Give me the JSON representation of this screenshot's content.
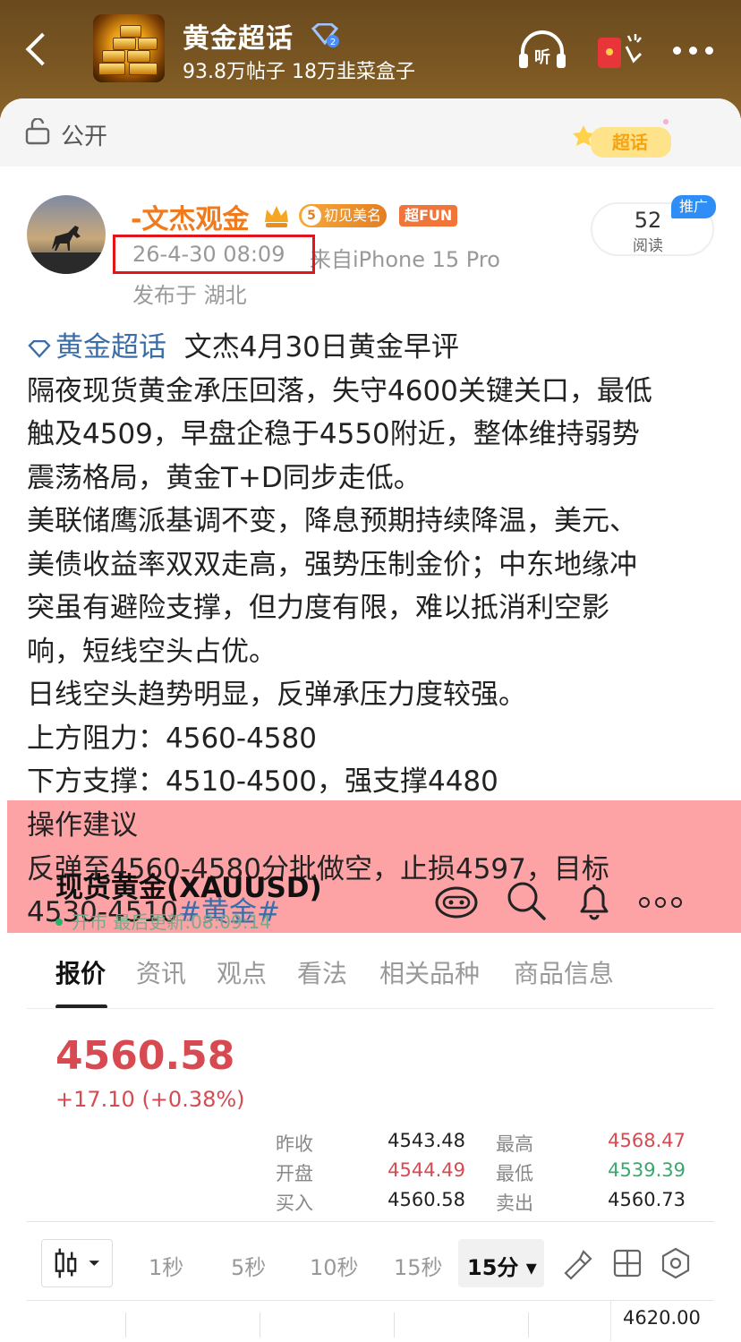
{
  "header": {
    "topic_name": "黄金超话",
    "topic_stats": "93.8万帖子 18万韭菜盒子",
    "icons": [
      "back-arrow-icon",
      "verified-diamond-icon",
      "listen-icon",
      "red-packet-icon",
      "more-icon"
    ]
  },
  "visibility": {
    "label": "公开",
    "icon": "unlock-icon",
    "badge_text": "超话"
  },
  "author": {
    "name": "-文杰观金",
    "level": "5",
    "badge_meet": "初见美名",
    "badge_fun": "超FUN",
    "time": "26-4-30 08:09",
    "source": "来自iPhone 15 Pro",
    "location": "发布于 湖北"
  },
  "reads": {
    "count": "52",
    "label": "阅读",
    "promo": "推广"
  },
  "post": {
    "topic_link": "黄金超话",
    "lines": [
      "文杰4月30日黄金早评",
      "隔夜现货黄金承压回落，失守4600关键关口，最低",
      "触及4509，早盘企稳于4550附近，整体维持弱势",
      "震荡格局，黄金T+D同步走低。",
      "美联储鹰派基调不变，降息预期持续降温，美元、",
      "美债收益率双双走高，强势压制金价；中东地缘冲",
      "突虽有避险支撑，但力度有限，难以抵消利空影",
      "响，短线空头占优。",
      "日线空头趋势明显，反弹承压力度较强。",
      "上方阻力：4560-4580",
      "下方支撑：4510-4500，强支撑4480"
    ],
    "advice_lines": [
      "操作建议",
      "反弹至4560-4580分批做空，止损4597，目标"
    ],
    "advice_last": " 4530-4510",
    "hashtag": "#黄金#"
  },
  "quote": {
    "title": "现货黄金(XAUUSD)",
    "status": "开市 最后更新:08:09:14",
    "tabs": [
      "报价",
      "资讯",
      "观点",
      "看法",
      "相关品种",
      "商品信息"
    ],
    "price": "4560.58",
    "change": "+17.10 (+0.38%)",
    "fields": {
      "prev_close_label": "昨收",
      "prev_close": "4543.48",
      "open_label": "开盘",
      "open": "4544.49",
      "bid_label": "买入",
      "bid": "4560.58",
      "high_label": "最高",
      "high": "4568.47",
      "low_label": "最低",
      "low": "4539.39",
      "ask_label": "卖出",
      "ask": "4560.73"
    },
    "timeframes": [
      "1秒",
      "5秒",
      "10秒",
      "15秒",
      "15分"
    ],
    "chart_axis_top": "4620.00",
    "colors": {
      "up": "#d84a52",
      "down": "#3aa86e",
      "header": "#7a5622",
      "advice_highlight": "#fda3a6"
    }
  }
}
